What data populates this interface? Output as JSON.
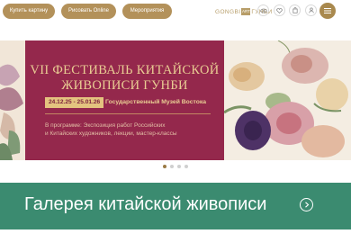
{
  "header": {
    "buttons": [
      "Купить картину",
      "Рисовать Online",
      "Мероприятия"
    ],
    "logo_left": "GONGBI",
    "logo_mark": "ART",
    "logo_right": "ГУНБИ",
    "icons": [
      "eye-icon",
      "heart-icon",
      "cart-icon",
      "user-icon",
      "menu-icon"
    ]
  },
  "banner": {
    "title_line1": "VII ФЕСТИВАЛЬ КИТАЙСКОЙ",
    "title_line2": "ЖИВОПИСИ ГУНБИ",
    "dates": "24.12.25 - 25.01.26",
    "venue": "Государственный Музей Востока",
    "program_line1": "В программе: Экспозиция работ Российских",
    "program_line2": "и Китайских художников, лекции, мастер-классы",
    "slide_count": 4,
    "active_slide": 1
  },
  "gallery": {
    "title": "Галерея китайской живописи"
  },
  "colors": {
    "accent_gold": "#b3915a",
    "banner_red": "#94284c",
    "gallery_green": "#3b8b70"
  }
}
